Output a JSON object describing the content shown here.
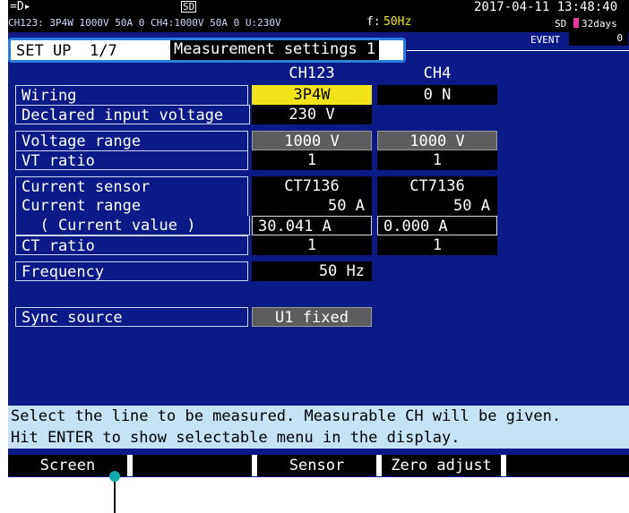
{
  "status_bar": {
    "row1_left": "=D▸",
    "sd_icon": "sd-card-icon",
    "datetime": "2017-04-11  13:48:40",
    "row2_text": "CH123:  3P4W    1000V    50A 0  CH4:1000V    50A 0  U:230V",
    "freq_label": "f:",
    "freq_value": "50Hz",
    "sd_label": "SD",
    "sd_days": "32days",
    "event_label": "EVENT",
    "event_count": "0",
    "accent_color": "#e43a9b"
  },
  "header": {
    "setup_label": "SET UP",
    "page": "1/7",
    "title": "Measurement settings 1"
  },
  "columns": {
    "ch123": "CH123",
    "ch4": "CH4"
  },
  "rows": {
    "wiring": {
      "label": "Wiring",
      "ch123": "3P4W",
      "ch4": "0 N"
    },
    "declared_voltage": {
      "label": "Declared input voltage",
      "ch123": "230 V"
    },
    "voltage_range": {
      "label": "Voltage range",
      "ch123": "1000 V",
      "ch4": "1000 V"
    },
    "vt_ratio": {
      "label": "VT ratio",
      "ch123": "1",
      "ch4": "1"
    },
    "current_sensor": {
      "label": "Current sensor",
      "ch123": "CT7136",
      "ch4": "CT7136"
    },
    "current_range": {
      "label": "Current range",
      "ch123": "50 A",
      "ch4": "50 A"
    },
    "current_value": {
      "label": "  ( Current value )",
      "ch123": "30.041 A",
      "ch4": "0.000 A"
    },
    "ct_ratio": {
      "label": "CT ratio",
      "ch123": "1",
      "ch4": "1"
    },
    "frequency": {
      "label": "Frequency",
      "ch123": "50 Hz"
    },
    "sync_source": {
      "label": "Sync source",
      "ch123": "U1 fixed"
    }
  },
  "help": {
    "line1": "Select the line to be measured. Measurable CH will be given.",
    "line2": "Hit ENTER to show selectable menu in the display."
  },
  "function_keys": {
    "f1": "Screen",
    "f2": "",
    "f3": "Sensor",
    "f4": "Zero adjust",
    "f5": ""
  },
  "colors": {
    "background": "#0b1a86",
    "selected": "#f2e41a",
    "help_bg": "#c6e3f5",
    "header_border": "#2a7fe0"
  }
}
